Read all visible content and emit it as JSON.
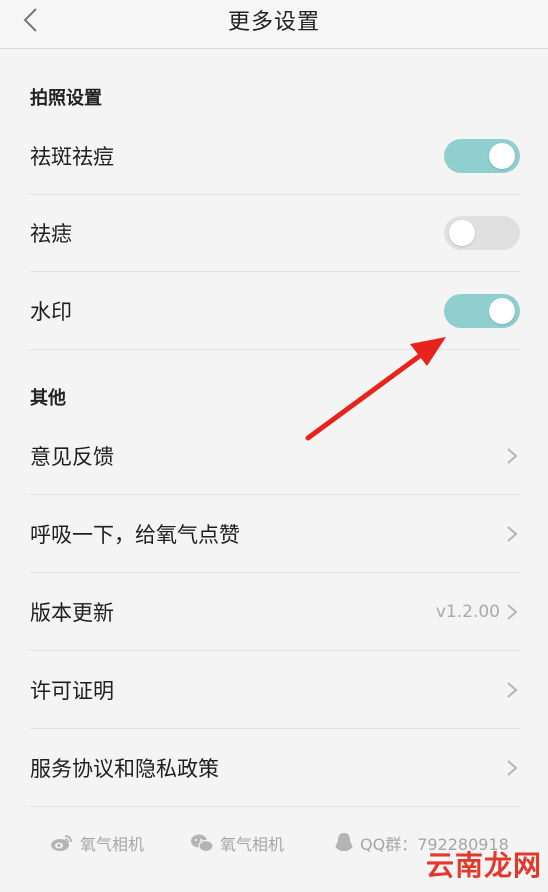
{
  "header": {
    "title": "更多设置"
  },
  "sections": {
    "camera": {
      "title": "拍照设置",
      "rows": [
        {
          "label": "祛斑祛痘",
          "on": true
        },
        {
          "label": "祛痣",
          "on": false
        },
        {
          "label": "水印",
          "on": true
        }
      ]
    },
    "other": {
      "title": "其他",
      "rows": [
        {
          "label": "意见反馈"
        },
        {
          "label": "呼吸一下，给氧气点赞"
        },
        {
          "label": "版本更新",
          "value": "v1.2.00"
        },
        {
          "label": "许可证明"
        },
        {
          "label": "服务协议和隐私政策"
        }
      ]
    }
  },
  "footer": {
    "weibo": "氧气相机",
    "wechat": "氧气相机",
    "qq": "QQ群：792280918"
  },
  "watermark": "云南龙网",
  "colors": {
    "toggle_on": "#8fcfcf",
    "toggle_off": "#e0e0e0",
    "arrow": "#e8231b"
  }
}
